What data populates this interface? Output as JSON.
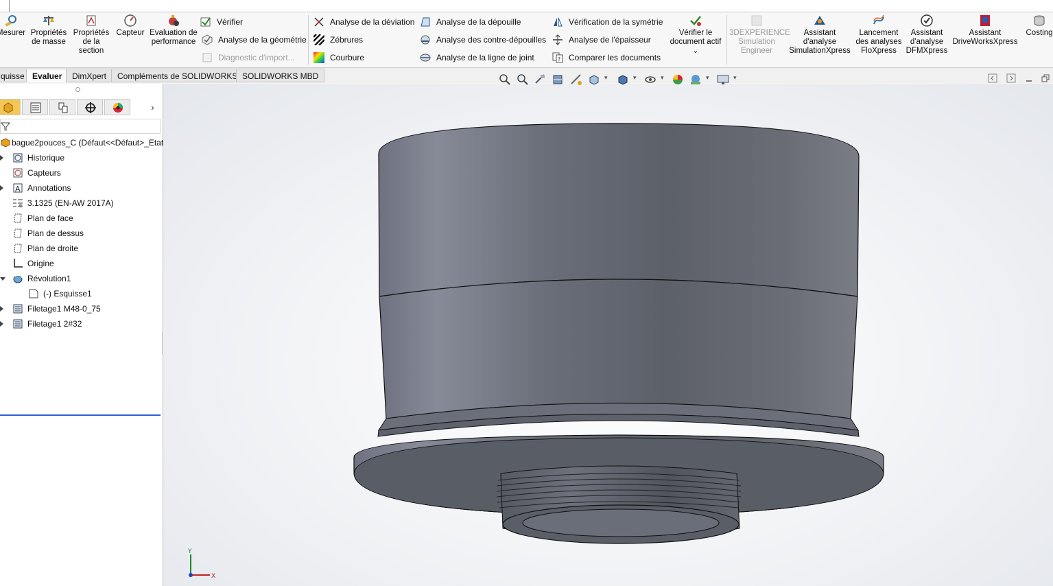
{
  "ribbon": {
    "left_buttons": [
      {
        "label": "Mesurer",
        "icon": "measure-icon"
      },
      {
        "label": "Propriétés de masse",
        "icon": "mass-properties-icon"
      },
      {
        "label": "Propriétés de la section",
        "icon": "section-properties-icon"
      },
      {
        "label": "Capteur",
        "icon": "sensor-icon"
      },
      {
        "label": "Evaluation de performance",
        "icon": "performance-icon"
      }
    ],
    "col1": [
      {
        "label": "Vérifier",
        "icon": "check-icon",
        "enabled": true
      },
      {
        "label": "Analyse de la géométrie",
        "icon": "geometry-analysis-icon",
        "enabled": true
      },
      {
        "label": "Diagnostic d'import...",
        "icon": "import-diagnostic-icon",
        "enabled": false
      }
    ],
    "col2": [
      {
        "label": "Analyse de la déviation",
        "icon": "deviation-icon"
      },
      {
        "label": "Zébrures",
        "icon": "zebra-icon"
      },
      {
        "label": "Courbure",
        "icon": "curvature-icon"
      }
    ],
    "col3": [
      {
        "label": "Analyse de la dépouille",
        "icon": "draft-analysis-icon"
      },
      {
        "label": "Analyse des contre-dépouilles",
        "icon": "undercut-icon"
      },
      {
        "label": "Analyse de la ligne de joint",
        "icon": "parting-line-icon"
      }
    ],
    "col4": [
      {
        "label": "Vérification de la symétrie",
        "icon": "symmetry-icon"
      },
      {
        "label": "Analyse de l'épaisseur",
        "icon": "thickness-icon"
      },
      {
        "label": "Comparer les documents",
        "icon": "compare-icon"
      }
    ],
    "verify_active": {
      "label": "Vérifier le document actif",
      "arrow": "⌄"
    },
    "right_buttons": [
      {
        "label": "3DEXPERIENCE Simulation Engineer",
        "icon": "3dexperience-icon",
        "enabled": false
      },
      {
        "label": "Assistant d'analyse SimulationXpress",
        "icon": "simulationxpress-icon",
        "enabled": true
      },
      {
        "label": "Lancement des analyses FloXpress",
        "icon": "floxpress-icon",
        "enabled": true
      },
      {
        "label": "Assistant d'analyse DFMXpress",
        "icon": "dfmxpress-icon",
        "enabled": true
      },
      {
        "label": "Assistant DriveWorksXpress",
        "icon": "driveworks-icon",
        "enabled": true
      },
      {
        "label": "Costing",
        "icon": "costing-icon",
        "enabled": true
      }
    ]
  },
  "tabs": [
    {
      "label": "quisse",
      "active": false
    },
    {
      "label": "Evaluer",
      "active": true
    },
    {
      "label": "DimXpert",
      "active": false
    },
    {
      "label": "Compléments de SOLIDWORKS",
      "active": false
    },
    {
      "label": "SOLIDWORKS MBD",
      "active": false
    }
  ],
  "tree": {
    "root": "bague2pouces_C  (Défaut<<Défaut>_Etat",
    "items": [
      {
        "label": "Historique",
        "icon": "history-icon",
        "expander": "closed",
        "indent": 0
      },
      {
        "label": "Capteurs",
        "icon": "sensor-folder-icon",
        "expander": "none",
        "indent": 0
      },
      {
        "label": "Annotations",
        "icon": "annotations-icon",
        "expander": "closed",
        "indent": 0
      },
      {
        "label": "3.1325 (EN-AW 2017A)",
        "icon": "material-icon",
        "expander": "none",
        "indent": 0
      },
      {
        "label": "Plan de face",
        "icon": "plane-icon",
        "expander": "none",
        "indent": 0
      },
      {
        "label": "Plan de dessus",
        "icon": "plane-icon",
        "expander": "none",
        "indent": 0
      },
      {
        "label": "Plan de droite",
        "icon": "plane-icon",
        "expander": "none",
        "indent": 0
      },
      {
        "label": "Origine",
        "icon": "origin-icon",
        "expander": "none",
        "indent": 0
      },
      {
        "label": "Révolution1",
        "icon": "revolve-icon",
        "expander": "open",
        "indent": 0
      },
      {
        "label": "(-) Esquisse1",
        "icon": "sketch-icon",
        "expander": "none",
        "indent": 1
      },
      {
        "label": "Filetage1 M48-0_75",
        "icon": "thread-icon",
        "expander": "closed",
        "indent": 0
      },
      {
        "label": "Filetage1 2#32",
        "icon": "thread-icon",
        "expander": "closed",
        "indent": 0
      }
    ]
  },
  "triad": {
    "y_label": "Y",
    "x_label": "X"
  },
  "colors": {
    "part_face": "#5f636b",
    "part_highlight": "#858995",
    "selection": "#2d5bd7",
    "active_tab": "#f3c757"
  }
}
